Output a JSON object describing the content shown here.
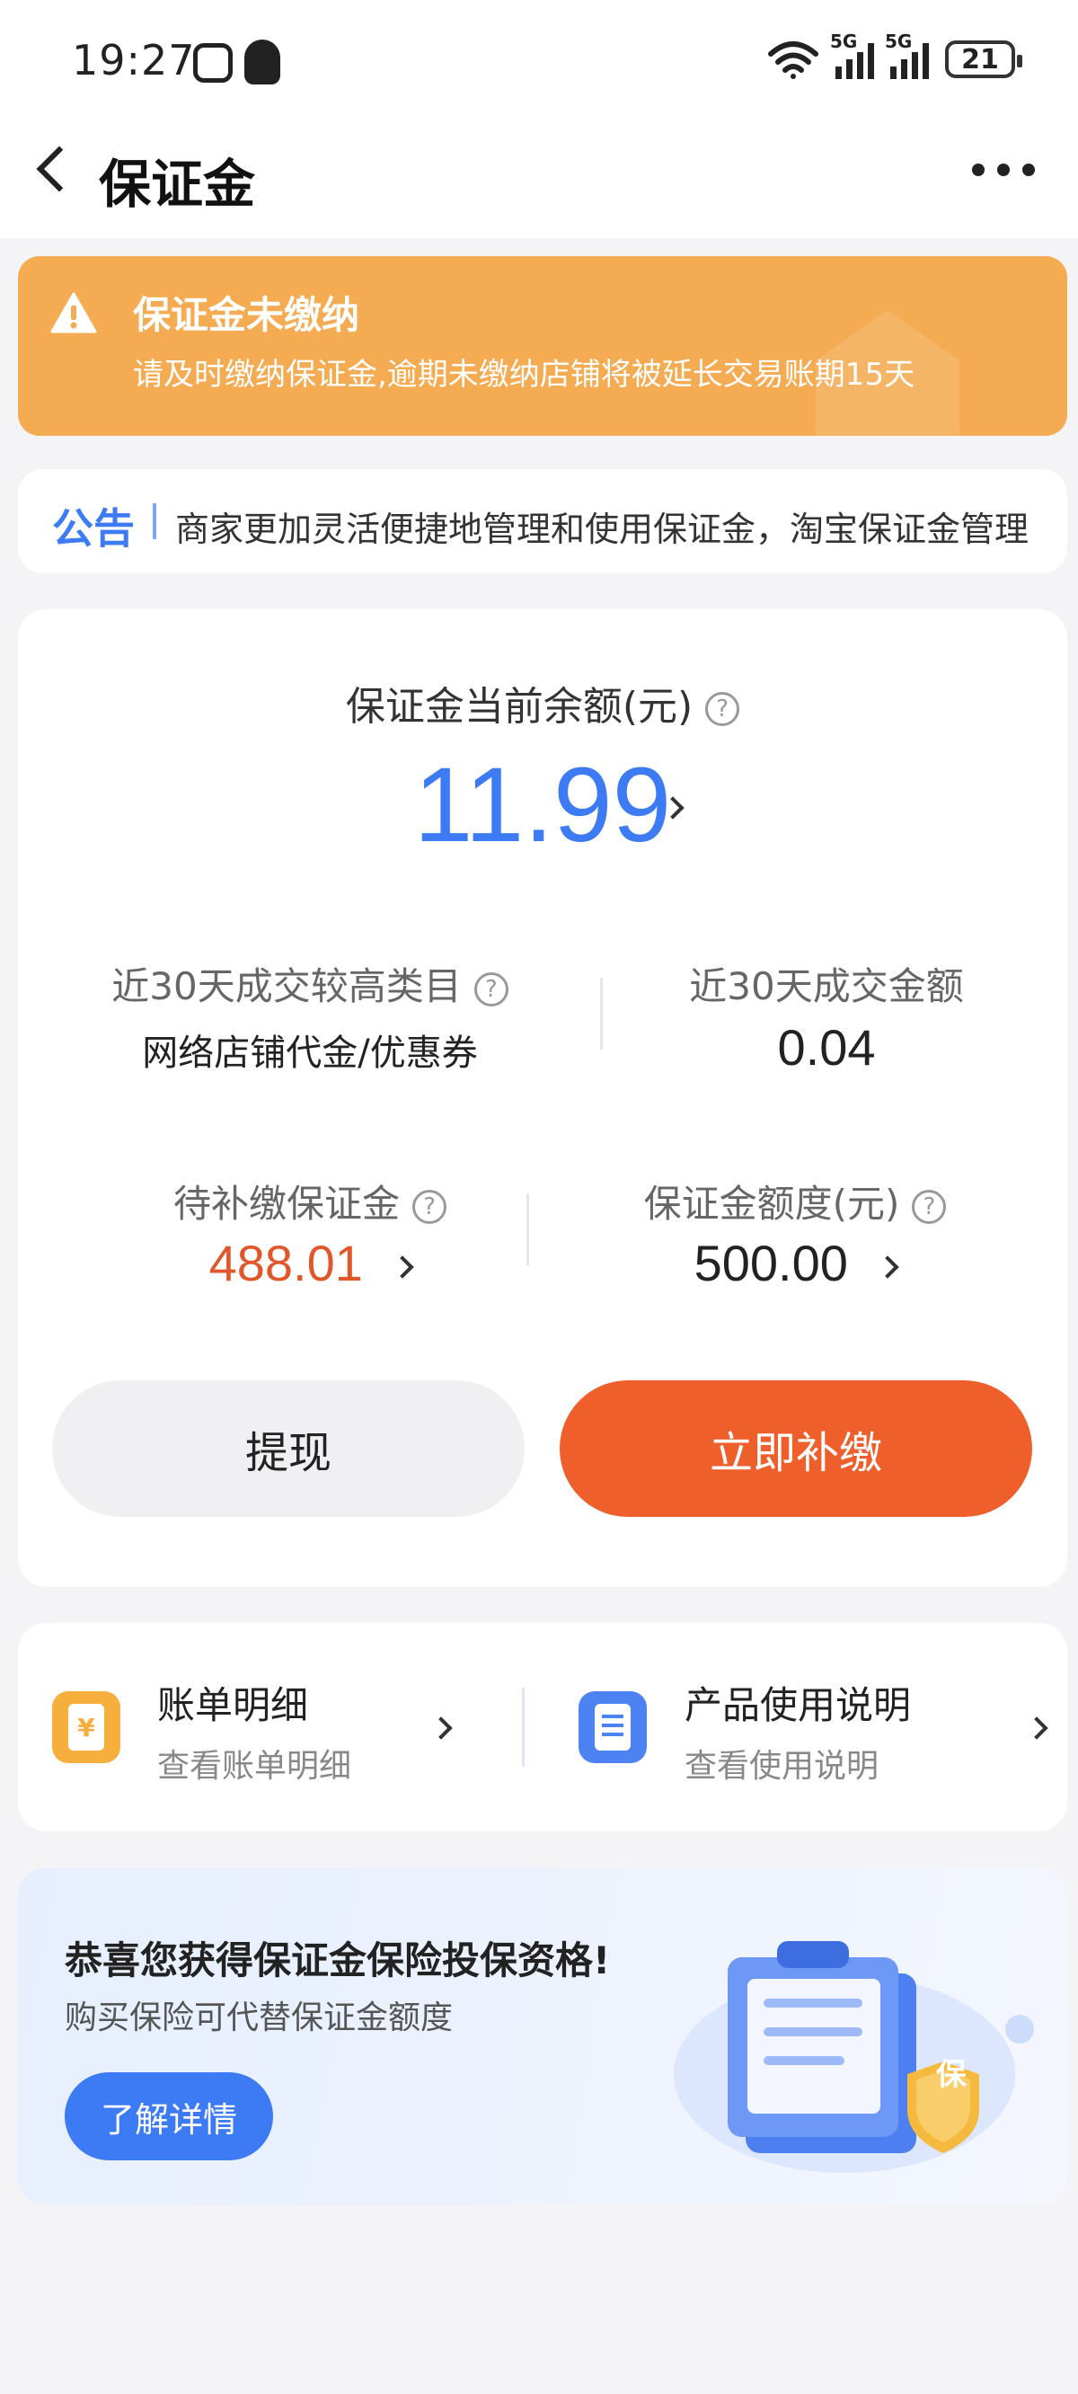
{
  "status_bar": {
    "time": "19:27",
    "network_tag_1": "5G",
    "network_tag_2": "5G",
    "battery": "21"
  },
  "nav": {
    "title": "保证金"
  },
  "warning": {
    "title": "保证金未缴纳",
    "text": "请及时缴纳保证金,逾期未缴纳店铺将被延长交易账期15天"
  },
  "notice": {
    "tag": "公告",
    "text": "商家更加灵活便捷地管理和使用保证金，淘宝保证金管理"
  },
  "balance": {
    "label": "保证金当前余额(元)",
    "value": "11.99"
  },
  "stats": {
    "top_category_label": "近30天成交较高类目",
    "top_category_value": "网络店铺代金/优惠券",
    "amount_label": "近30天成交金额",
    "amount_value": "0.04",
    "pending_label": "待补缴保证金",
    "pending_value": "488.01",
    "quota_label": "保证金额度(元)",
    "quota_value": "500.00"
  },
  "buttons": {
    "withdraw": "提现",
    "pay_now": "立即补缴"
  },
  "links": {
    "bill_title": "账单明细",
    "bill_sub": "查看账单明细",
    "guide_title": "产品使用说明",
    "guide_sub": "查看使用说明"
  },
  "insurance": {
    "title": "恭喜您获得保证金保险投保资格!",
    "subtitle": "购买保险可代替保证金额度",
    "button": "了解详情",
    "shield_char": "保"
  },
  "colors": {
    "accent_blue": "#3d7bf5",
    "warning_orange": "#f4ab52",
    "pay_orange": "#ee5f2b",
    "pending_red": "#e0572a"
  }
}
